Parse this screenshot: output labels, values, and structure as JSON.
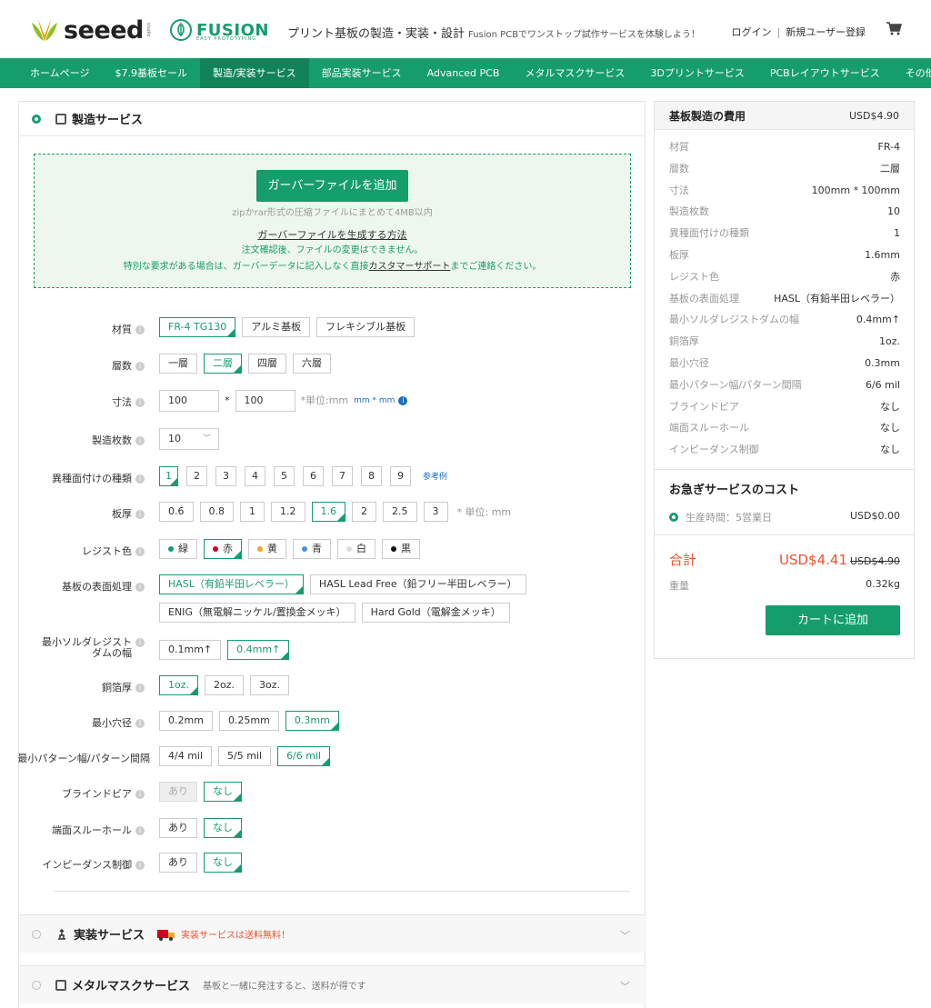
{
  "header": {
    "logo_text": "seeed",
    "logo_small": "studio",
    "fusion_logo": "FUSION",
    "fusion_sub": "EASY PROTOTYPING",
    "tagline": "プリント基板の製造・実装・設計",
    "tagline_sub": "Fusion PCBでワンストップ試作サービスを体験しよう！",
    "login": "ログイン",
    "register": "新規ユーザー登録",
    "sep": "|"
  },
  "nav": [
    "ホームページ",
    "$7.9基板セール",
    "製造/実装サービス",
    "部品実装サービス",
    "Advanced PCB",
    "メタルマスクサービス",
    "3Dプリントサービス",
    "PCBレイアウトサービス",
    "その他"
  ],
  "section": {
    "title": "製造サービス",
    "upload_button": "ガーバーファイルを追加",
    "upload_note1": "zipかrar形式の圧縮ファイルにまとめて4MB以内",
    "upload_note2": "ガーバーファイルを生成する方法",
    "upload_note3": "注文確認後、ファイルの変更はできません。",
    "upload_note4a": "特別な要求がある場合は、ガーバーデータに記入しなく直接",
    "upload_note4b": "カスタマーサポート",
    "upload_note4c": "までご連絡ください。"
  },
  "form": {
    "material": {
      "label": "材質",
      "options": [
        "FR-4 TG130",
        "アルミ基板",
        "フレキシブル基板"
      ]
    },
    "layers": {
      "label": "層数",
      "options": [
        "一層",
        "二層",
        "四層",
        "六層"
      ]
    },
    "dims": {
      "label": "寸法",
      "w": "100",
      "h": "100",
      "x": "*",
      "unit": "*単位:mm",
      "alt_unit": "mm * mm"
    },
    "qty": {
      "label": "製造枚数",
      "value": "10",
      "chev": "﹀"
    },
    "designs": {
      "label": "異種面付けの種類",
      "options": [
        "1",
        "2",
        "3",
        "4",
        "5",
        "6",
        "7",
        "8",
        "9"
      ],
      "link": "参考例"
    },
    "thickness": {
      "label": "板厚",
      "options": [
        "0.6",
        "0.8",
        "1",
        "1.2",
        "1.6",
        "2",
        "2.5",
        "3"
      ],
      "unit": "* 単位: mm"
    },
    "mask_color": {
      "label": "レジスト色",
      "options": [
        "緑",
        "赤",
        "黄",
        "青",
        "白",
        "黒"
      ]
    },
    "finish": {
      "label": "基板の表面処理",
      "options": [
        "HASL（有鉛半田レベラー）",
        "HASL Lead Free（鉛フリー半田レベラー）",
        "ENIG（無電解ニッケル/置換金メッキ）",
        "Hard Gold（電解金メッキ）"
      ]
    },
    "min_mask": {
      "label1": "最小ソルダレジスト",
      "label2": "ダムの幅",
      "options": [
        "0.1mm↑",
        "0.4mm↑"
      ]
    },
    "copper": {
      "label": "銅箔厚",
      "options": [
        "1oz.",
        "2oz.",
        "3oz."
      ]
    },
    "min_hole": {
      "label": "最小穴径",
      "options": [
        "0.2mm",
        "0.25mm",
        "0.3mm"
      ]
    },
    "min_trace": {
      "label": "最小パターン幅/パターン間隔",
      "options": [
        "4/4 mil",
        "5/5 mil",
        "6/6 mil"
      ]
    },
    "blind_via": {
      "label": "ブラインドビア",
      "options": [
        "あり",
        "なし"
      ]
    },
    "castellated": {
      "label": "端面スルーホール",
      "options": [
        "あり",
        "なし"
      ]
    },
    "impedance": {
      "label": "インピーダンス制御",
      "options": [
        "あり",
        "なし"
      ]
    }
  },
  "assembly": {
    "title": "実装サービス",
    "promo": "実装サービスは送料無料！",
    "chev": "﹀"
  },
  "stencil": {
    "title": "メタルマスクサービス",
    "promo": "基板と一緒に発注すると、送料が得です",
    "chev": "﹀"
  },
  "summary": {
    "title": "基板製造の費用",
    "price": "USD$4.90",
    "specs": [
      {
        "k": "材質",
        "v": "FR-4"
      },
      {
        "k": "層数",
        "v": "二層"
      },
      {
        "k": "寸法",
        "v": "100mm * 100mm"
      },
      {
        "k": "製造枚数",
        "v": "10"
      },
      {
        "k": "異種面付けの種類",
        "v": "1"
      },
      {
        "k": "板厚",
        "v": "1.6mm"
      },
      {
        "k": "レジスト色",
        "v": "赤"
      },
      {
        "k": "基板の表面処理",
        "v": "HASL（有鉛半田レベラー）"
      },
      {
        "k": "最小ソルダレジストダムの幅",
        "v": "0.4mm↑"
      },
      {
        "k": "銅箔厚",
        "v": "1oz."
      },
      {
        "k": "最小穴径",
        "v": "0.3mm"
      },
      {
        "k": "最小パターン幅/パターン間隔",
        "v": "6/6 mil"
      },
      {
        "k": "ブラインドビア",
        "v": "なし"
      },
      {
        "k": "端面スルーホール",
        "v": "なし"
      },
      {
        "k": "インピーダンス制御",
        "v": "なし"
      }
    ],
    "rush_title": "お急ぎサービスのコスト",
    "rush_label": "生産時間：5営業日",
    "rush_price": "USD$0.00",
    "total_label": "合計",
    "total_price": "USD$4.41",
    "total_old": "USD$4.90",
    "weight_label": "重量",
    "weight": "0.32kg",
    "cart_button": "カートに追加"
  },
  "colors": {
    "brand": "#169D6C",
    "accent": "#f0522f"
  }
}
